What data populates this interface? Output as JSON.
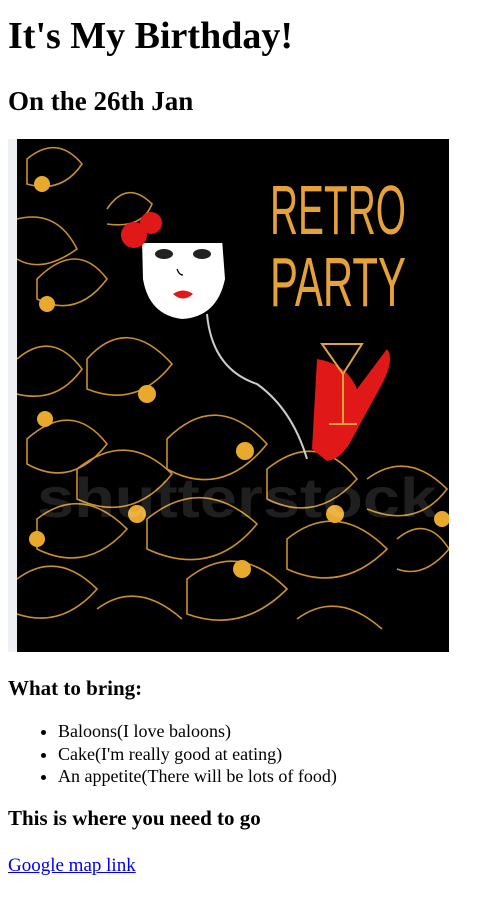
{
  "page": {
    "title": "It's My Birthday!",
    "date_heading": "On the 26th Jan",
    "poster": {
      "headline_line1": "RETRO",
      "headline_line2": "PARTY",
      "watermark": "shutterstock",
      "colors": {
        "background": "#000000",
        "gold": "#e0a23a",
        "red": "#e01818",
        "skin": "#ffffff"
      }
    },
    "bring_heading": "What to bring:",
    "bring_items": [
      "Baloons(I love baloons)",
      "Cake(I'm really good at eating)",
      "An appetite(There will be lots of food)"
    ],
    "directions_heading": "This is where you need to go",
    "map_link_text": "Google map link"
  }
}
